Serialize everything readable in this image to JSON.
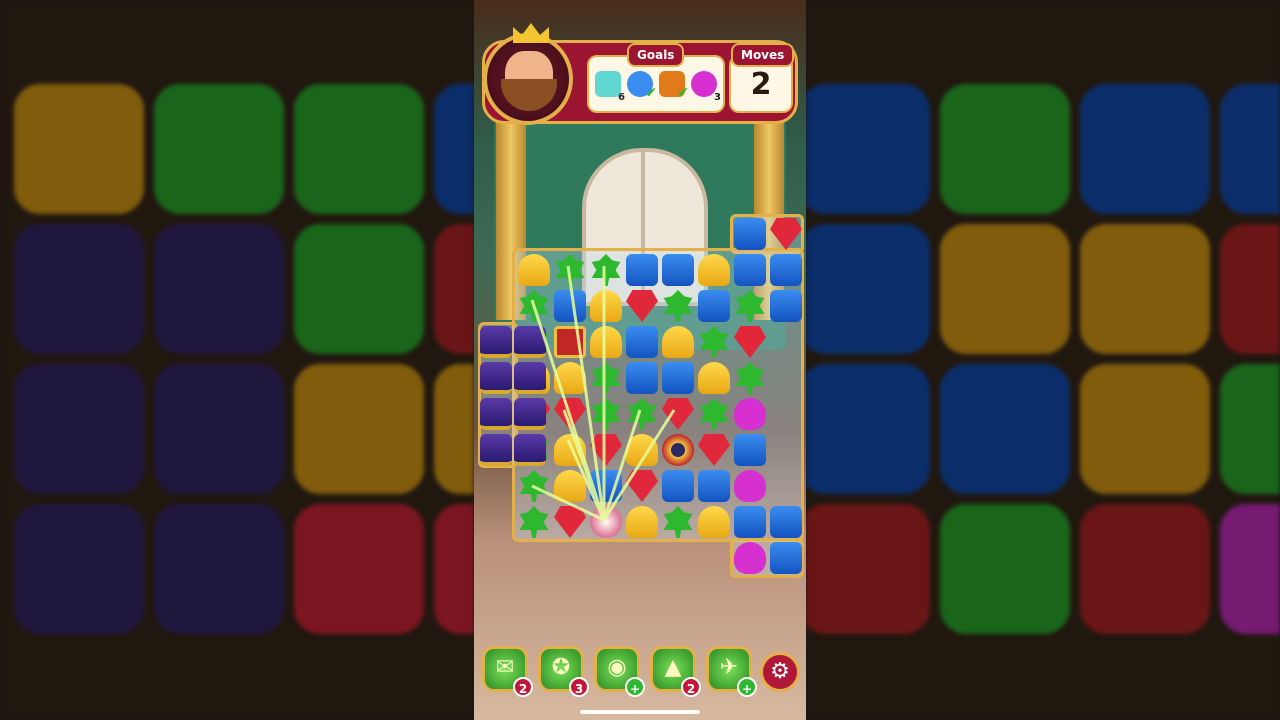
{
  "hud": {
    "goals_label": "Goals",
    "moves_label": "Moves",
    "moves_value": "2",
    "goals": [
      {
        "icon": "tile-icon",
        "count": "6",
        "color": "#5fd6d0"
      },
      {
        "icon": "character-icon",
        "count": "",
        "done": true
      },
      {
        "icon": "box-icon",
        "count": "",
        "done": true,
        "color": "#e07a1a"
      },
      {
        "icon": "tulip-icon",
        "count": "3",
        "color": "#d630d0"
      }
    ]
  },
  "boosters": [
    {
      "icon": "mailbox-booster-icon",
      "count": "2"
    },
    {
      "icon": "cannon-booster-icon",
      "count": "3"
    },
    {
      "icon": "bomb-booster-icon",
      "count": "+"
    },
    {
      "icon": "wizard-hat-booster-icon",
      "count": "2"
    },
    {
      "icon": "toy-plane-booster-icon",
      "count": "+"
    }
  ],
  "settings_icon": "gear-icon",
  "board": {
    "rows": [
      [
        "",
        "",
        "",
        "",
        "",
        "",
        "blue",
        "red"
      ],
      [
        "yellow",
        "green",
        "green",
        "blue",
        "blue",
        "yellow",
        "blue",
        "blue"
      ],
      [
        "green",
        "blue",
        "yellow",
        "red",
        "green",
        "blue",
        "green",
        "blue"
      ],
      [
        "green",
        "chest",
        "yellow",
        "blue",
        "yellow",
        "green",
        "red",
        ""
      ],
      [
        "yellow",
        "yellow",
        "green",
        "blue",
        "blue",
        "yellow",
        "green",
        ""
      ],
      [
        "red",
        "red",
        "green",
        "green",
        "red",
        "green",
        "pink",
        ""
      ],
      [
        "green",
        "yellow",
        "red",
        "yellow",
        "spinner",
        "red",
        "blue",
        ""
      ],
      [
        "green",
        "yellow",
        "blue",
        "red",
        "blue",
        "blue",
        "pink",
        ""
      ],
      [
        "green",
        "red",
        "special",
        "yellow",
        "green",
        "yellow",
        "blue",
        "blue"
      ],
      [
        "",
        "",
        "",
        "",
        "",
        "",
        "pink",
        "blue"
      ]
    ],
    "left_column": [
      "purple",
      "purple",
      "purple",
      "purple",
      "purple",
      "purple",
      "purple",
      "purple"
    ]
  }
}
